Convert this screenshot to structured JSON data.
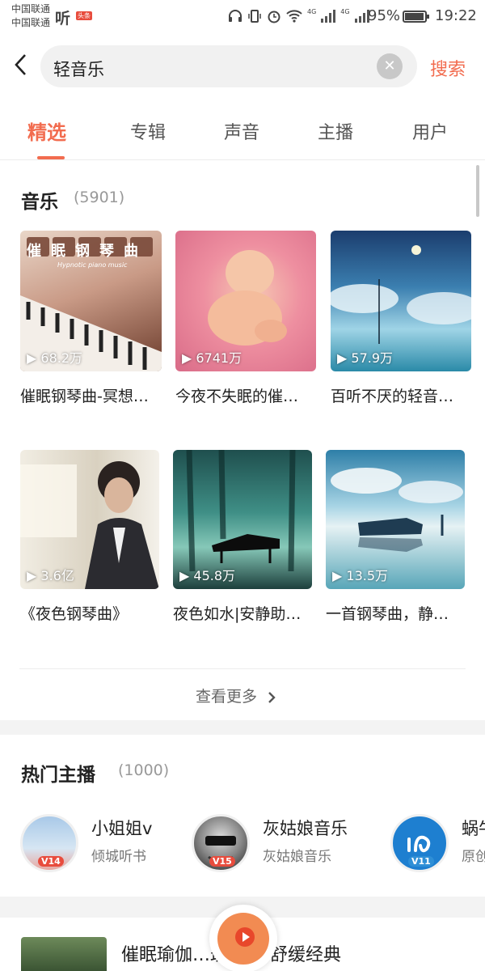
{
  "status_bar": {
    "carrier_1": "中国联通",
    "carrier_2": "中国联通",
    "app_tag": "听",
    "app_badge": "头条",
    "network_1": "4G",
    "network_2": "4G",
    "battery": "95%",
    "battery_level": 0.95,
    "time": "19:22"
  },
  "search": {
    "query": "轻音乐",
    "search_button": "搜索"
  },
  "tabs": [
    "精选",
    "专辑",
    "声音",
    "主播",
    "用户"
  ],
  "active_tab": "精选",
  "music_section": {
    "title": "音乐",
    "count": "(5901)",
    "items": [
      {
        "plays": "68.2万",
        "title": "催眠钢琴曲-冥想…",
        "cover_text": "催眠钢琴曲",
        "cover_subtext": "Hypnotic piano music"
      },
      {
        "plays": "6741万",
        "title": "今夜不失眠的催…"
      },
      {
        "plays": "57.9万",
        "title": "百听不厌的轻音…"
      },
      {
        "plays": "3.6亿",
        "title": "《夜色钢琴曲》"
      },
      {
        "plays": "45.8万",
        "title": "夜色如水|安静助…"
      },
      {
        "plays": "13.5万",
        "title": "一首钢琴曲，静…"
      }
    ],
    "more": "查看更多"
  },
  "anchor_section": {
    "title": "热门主播",
    "count": "(1000)",
    "anchors": [
      {
        "name": "小姐姐v",
        "subtitle": "倾城听书",
        "level": "V14"
      },
      {
        "name": "灰姑娘音乐",
        "subtitle": "灰姑娘音乐",
        "level": "V15"
      },
      {
        "name": "蜗牛",
        "subtitle": "原创",
        "level": "V11"
      }
    ]
  },
  "bottom_album": {
    "title": "催眠瑜伽…班得瑞-舒缓经典"
  },
  "icons": {
    "back": "chevron-left-icon",
    "clear": "clear-icon",
    "play": "play-icon",
    "more": "chevron-right-icon",
    "fab": "player-fab-icon"
  },
  "colors": {
    "accent": "#f26c4f",
    "badge_red": "#e84c3d",
    "badge_blue": "#2f8fd6"
  }
}
